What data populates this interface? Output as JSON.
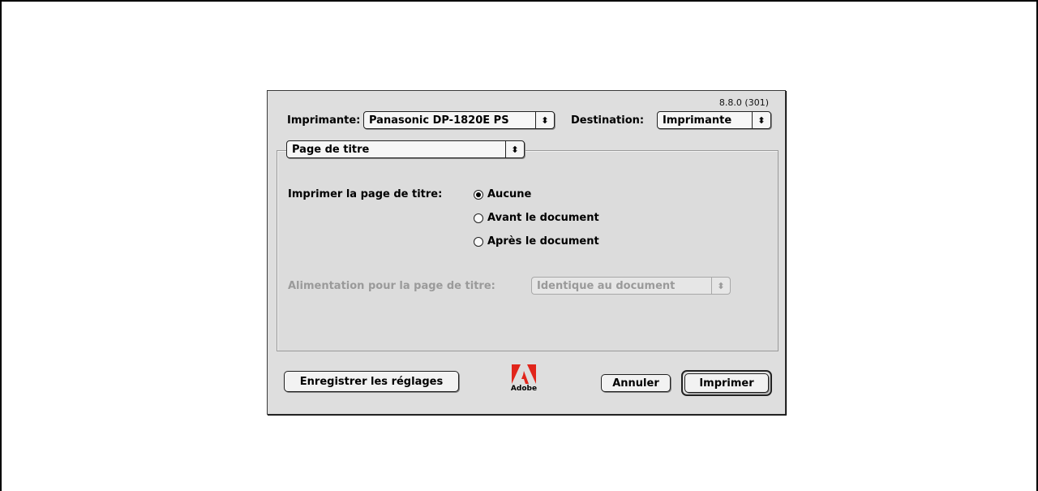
{
  "dialog": {
    "version": "8.8.0 (301)",
    "printer_label": "Imprimante:",
    "printer_value": "Panasonic DP-1820E PS",
    "destination_label": "Destination:",
    "destination_value": "Imprimante",
    "panel_value": "Page de titre",
    "cover_page_label": "Imprimer la page de titre:",
    "radio_options": [
      "Aucune",
      "Avant le document",
      "Après le document"
    ],
    "selected_option": "Aucune",
    "paper_source_label": "Alimentation pour la page de titre:",
    "paper_source_value": "Identique au document",
    "save_settings_button": "Enregistrer les réglages",
    "logo_word": "Adobe",
    "cancel_button": "Annuler",
    "print_button": "Imprimer"
  },
  "icons": {
    "popup_arrows": "up-down-arrows-icon",
    "logo": "adobe-logo"
  },
  "colors": {
    "dialog_background": "#dedede",
    "disabled_text": "#9a9a9a",
    "adobe_red": "#e1251b"
  }
}
